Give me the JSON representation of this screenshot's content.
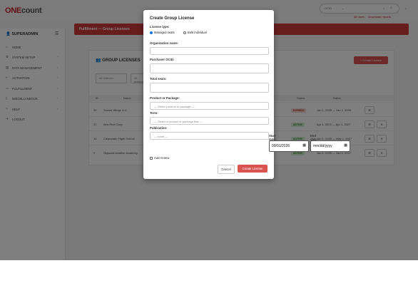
{
  "header": {
    "logo_one": "ONE",
    "logo_rest": "count",
    "search_select": "OCID",
    "links": [
      "All users",
      "Download reports"
    ]
  },
  "sidebar": {
    "role": "SUPERADMIN",
    "items": [
      {
        "label": "HOME",
        "icon": "home-icon"
      },
      {
        "label": "SYSTEM SETUP",
        "icon": "gear-icon"
      },
      {
        "label": "DATA MANAGEMENT",
        "icon": "database-icon"
      },
      {
        "label": "ACTIVATION",
        "icon": "toggle-icon"
      },
      {
        "label": "FULFILLMENT",
        "icon": "ticket-icon"
      },
      {
        "label": "MISCELLANEOUS",
        "icon": "file-icon"
      },
      {
        "label": "HELP",
        "icon": "question-icon"
      },
      {
        "label": "LOGOUT",
        "icon": "logout-icon"
      }
    ]
  },
  "main": {
    "banner_title": "Fulfillment — Group Licenses",
    "card_title": "GROUP LICENSES",
    "create_button": "+ Create License",
    "filters": [
      "All statuses",
      "All publications"
    ],
    "columns": [
      "ID",
      "Name",
      "Status",
      "Dates"
    ],
    "rows": [
      {
        "id": "30",
        "name": "Sunset Wings LLC",
        "status": "EXPIRED",
        "dates": "Jan 1, 2025 — Jan 1, 2026"
      },
      {
        "id": "22",
        "name": "AeroTech Corp",
        "status": "ACTIVE",
        "dates": "Apr 1, 2025 — Apr 1, 2027"
      },
      {
        "id": "14",
        "name": "Clearwater Flight School",
        "status": "ACTIVE",
        "dates": "Jun 1, 2025 — May 1, 2027"
      },
      {
        "id": "9",
        "name": "Skyward Aviation Academy",
        "status": "ACTIVE",
        "dates": "Jan 1, 2025 — Jan 1, 2027"
      }
    ]
  },
  "modal": {
    "title": "Create Group License",
    "license_type_label": "License type:",
    "radio_managed": "Managed seats",
    "radio_bulk": "Bulk individual",
    "org_label": "Organization name:",
    "purchaser_label": "Purchaser OCID:",
    "seats_label": "Total seats:",
    "product_label": "Product or Package:",
    "product_placeholder": "— Select product or package —",
    "term_label": "Term:",
    "term_placeholder": "— Select a product or package first —",
    "publication_label": "Publication:",
    "publication_placeholder": "— none —",
    "start_label": "Start date:",
    "start_value": "09/01/2026",
    "end_label": "End date:",
    "end_value": "mm/dd/yyyy",
    "auto_renew": "Auto-renew",
    "cancel": "Cancel",
    "create": "Create License"
  }
}
